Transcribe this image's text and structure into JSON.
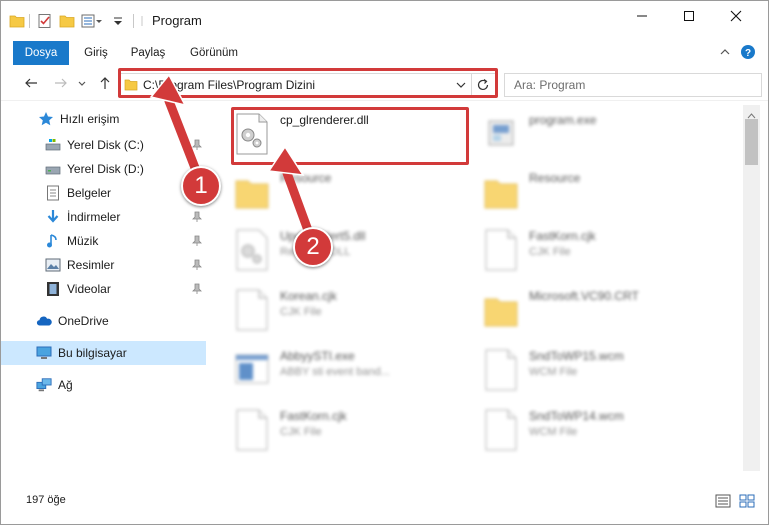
{
  "window": {
    "title": "Program",
    "controls": {
      "minimize": "minimize-icon",
      "maximize": "maximize-icon",
      "close": "close-icon"
    }
  },
  "ribbon": {
    "tabs": [
      {
        "label": "Dosya"
      },
      {
        "label": "Giriş"
      },
      {
        "label": "Paylaş"
      },
      {
        "label": "Görünüm"
      }
    ]
  },
  "address": {
    "path": "C:\\Program Files\\Program Dizini"
  },
  "search": {
    "placeholder": "Ara: Program"
  },
  "sidebar": {
    "items": [
      {
        "label": "Hızlı erişim",
        "icon": "star-icon"
      },
      {
        "label": "Yerel Disk (C:)",
        "icon": "drive-icon"
      },
      {
        "label": "Yerel Disk (D:)",
        "icon": "drive-icon"
      },
      {
        "label": "Belgeler",
        "icon": "document-icon"
      },
      {
        "label": "İndirmeler",
        "icon": "download-icon"
      },
      {
        "label": "Müzik",
        "icon": "music-icon"
      },
      {
        "label": "Resimler",
        "icon": "pictures-icon"
      },
      {
        "label": "Videolar",
        "icon": "video-icon"
      },
      {
        "label": "OneDrive",
        "icon": "cloud-icon"
      },
      {
        "label": "Bu bilgisayar",
        "icon": "computer-icon"
      },
      {
        "label": "Ağ",
        "icon": "network-icon"
      }
    ]
  },
  "files": [
    {
      "name": "cp_glrenderer.dll",
      "type": "",
      "icon": "dll-gear-icon"
    },
    {
      "name": "program.exe",
      "type": "",
      "icon": "exe-icon"
    },
    {
      "name": "Resource",
      "type": "",
      "icon": "folder-icon"
    },
    {
      "name": "Resource",
      "type": "",
      "icon": "folder-icon"
    },
    {
      "name": "UpdateAlert5.dll",
      "type": "Resource DLL",
      "icon": "dll-gear-icon"
    },
    {
      "name": "FastKorn.cjk",
      "type": "CJK File",
      "icon": "file-icon"
    },
    {
      "name": "Korean.cjk",
      "type": "CJK File",
      "icon": "file-icon"
    },
    {
      "name": "Microsoft.VC90.CRT",
      "type": "",
      "icon": "folder-icon"
    },
    {
      "name": "AbbyySTI.exe",
      "type": "ABBY sti event band...",
      "icon": "exe-window-icon"
    },
    {
      "name": "SndToWP15.wcm",
      "type": "WCM File",
      "icon": "file-icon"
    },
    {
      "name": "FastKorn.cjk",
      "type": "CJK File",
      "icon": "file-icon"
    },
    {
      "name": "SndToWP14.wcm",
      "type": "WCM File",
      "icon": "file-icon"
    }
  ],
  "status": {
    "count_text": "197 öğe"
  },
  "annotations": [
    {
      "label": "1"
    },
    {
      "label": "2"
    }
  ],
  "colors": {
    "accent": "#1979ca",
    "highlight": "#d23a3a",
    "selection": "#cce8ff"
  }
}
